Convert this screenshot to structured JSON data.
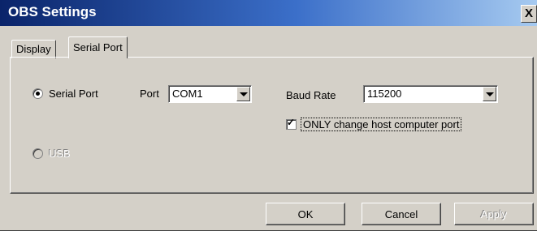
{
  "window": {
    "title": "OBS Settings",
    "close_glyph": "X"
  },
  "tabs": [
    {
      "label": "Display",
      "active": false
    },
    {
      "label": "Serial Port",
      "active": true
    }
  ],
  "serial_port_option": {
    "label": "Serial Port",
    "selected": true
  },
  "usb_option": {
    "label": "USB",
    "selected": false,
    "disabled": true
  },
  "port": {
    "label": "Port",
    "value": "COM1"
  },
  "baud_rate": {
    "label": "Baud Rate",
    "value": "115200"
  },
  "host_port_checkbox": {
    "label": "ONLY change host computer port",
    "checked": true,
    "tick": "✓"
  },
  "buttons": {
    "ok": "OK",
    "cancel": "Cancel",
    "apply": "Apply"
  }
}
